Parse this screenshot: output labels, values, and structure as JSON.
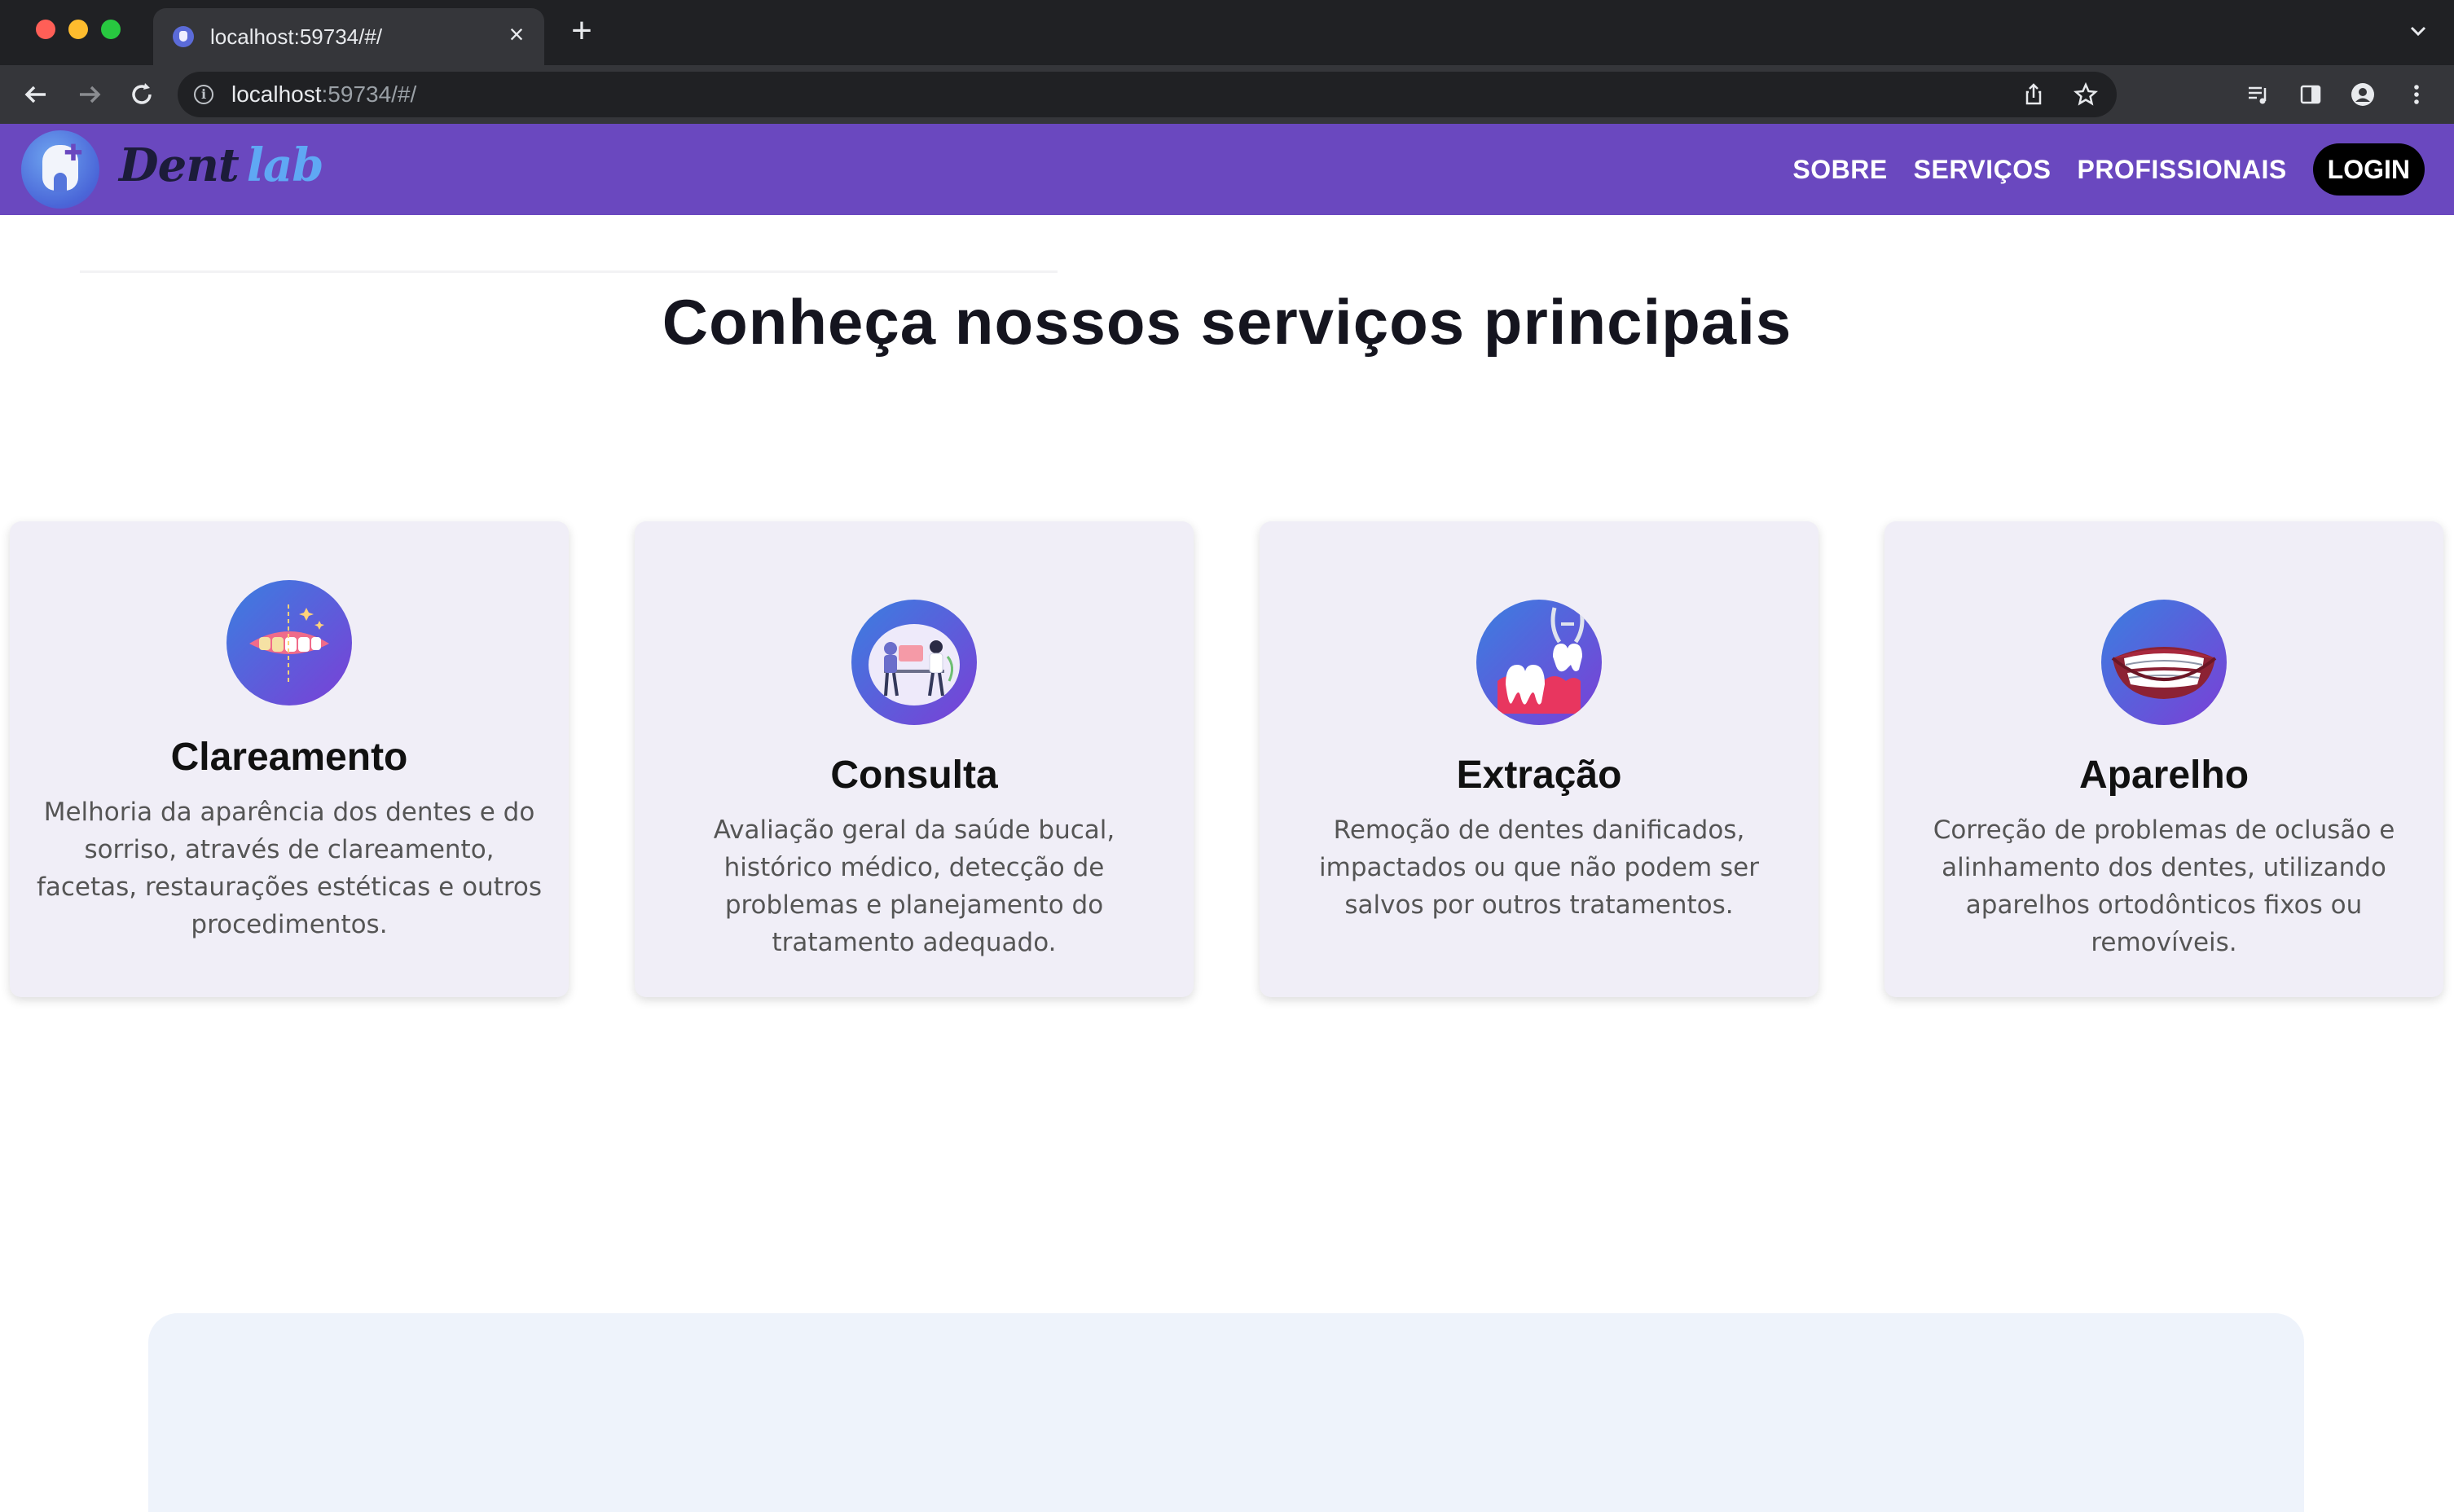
{
  "browser": {
    "tab_title": "localhost:59734/#/",
    "tab_close": "×",
    "new_tab": "+",
    "url_host": "localhost",
    "url_rest": ":59734/#/"
  },
  "site": {
    "brand_first": "Dent",
    "brand_second": "lab",
    "nav": {
      "sobre": "SOBRE",
      "servicos": "SERVIÇOS",
      "profissionais": "PROFISSIONAIS",
      "login": "LOGIN"
    }
  },
  "services": {
    "heading": "Conheça nossos serviços principais",
    "cards": [
      {
        "icon": "whitening-teeth-icon",
        "title": "Clareamento",
        "description": "Melhoria da aparência dos dentes e do sorriso, através de clareamento, facetas, restaurações estéticas e outros procedimentos."
      },
      {
        "icon": "consultation-icon",
        "title": "Consulta",
        "description": "Avaliação geral da saúde bucal, histórico médico, detecção de problemas e planejamento do tratamento adequado."
      },
      {
        "icon": "tooth-extraction-icon",
        "title": "Extração",
        "description": "Remoção de dentes danificados, impactados ou que não podem ser salvos por outros tratamentos."
      },
      {
        "icon": "braces-smile-icon",
        "title": "Aparelho",
        "description": "Correção de problemas de oclusão e alinhamento dos dentes, utilizando aparelhos ortodônticos fixos ou removíveis."
      }
    ]
  },
  "colors": {
    "header_bg": "#6a48bf",
    "card_bg": "#f0eef7",
    "brand_accent": "#5fa8f4",
    "login_bg": "#000000"
  }
}
